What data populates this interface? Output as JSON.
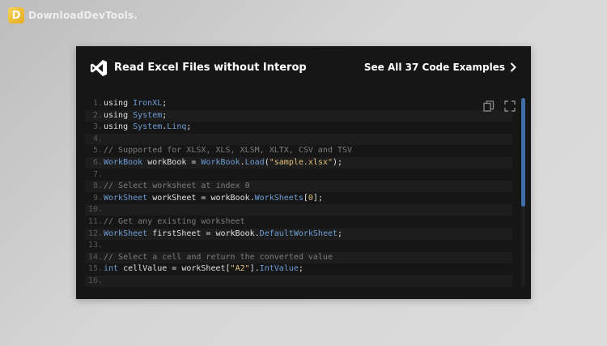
{
  "watermark": {
    "logo_letter": "D",
    "text": "DownloadDevTools."
  },
  "card": {
    "title": "Read Excel Files without Interop",
    "see_all_label": "See All 37 Code Examples",
    "accent_color": "#3f6ea8"
  },
  "icons": {
    "brand": "visual-studio-icon",
    "see_all": "chevron-right-icon",
    "copy": "copy-icon",
    "expand": "fullscreen-icon"
  },
  "code": [
    {
      "num": "1.",
      "tokens": [
        [
          "plain",
          "using "
        ],
        [
          "type",
          "IronXL"
        ],
        [
          "plain",
          ";"
        ]
      ]
    },
    {
      "num": "2.",
      "tokens": [
        [
          "plain",
          "using "
        ],
        [
          "type",
          "System"
        ],
        [
          "plain",
          ";"
        ]
      ]
    },
    {
      "num": "3.",
      "tokens": [
        [
          "plain",
          "using "
        ],
        [
          "type",
          "System"
        ],
        [
          "plain",
          "."
        ],
        [
          "type",
          "Linq"
        ],
        [
          "plain",
          ";"
        ]
      ]
    },
    {
      "num": "4.",
      "tokens": []
    },
    {
      "num": "5.",
      "tokens": [
        [
          "com",
          "// Supported for XLSX, XLS, XLSM, XLTX, CSV and TSV"
        ]
      ]
    },
    {
      "num": "6.",
      "tokens": [
        [
          "type",
          "WorkBook"
        ],
        [
          "plain",
          " workBook = "
        ],
        [
          "type",
          "WorkBook"
        ],
        [
          "plain",
          "."
        ],
        [
          "type",
          "Load"
        ],
        [
          "plain",
          "("
        ],
        [
          "str",
          "\"sample.xlsx\""
        ],
        [
          "plain",
          ");"
        ]
      ]
    },
    {
      "num": "7.",
      "tokens": []
    },
    {
      "num": "8.",
      "tokens": [
        [
          "com",
          "// Select worksheet at index 0"
        ]
      ]
    },
    {
      "num": "9.",
      "tokens": [
        [
          "type",
          "WorkSheet"
        ],
        [
          "plain",
          " workSheet = workBook."
        ],
        [
          "type",
          "WorkSheets"
        ],
        [
          "plain",
          "["
        ],
        [
          "num",
          "0"
        ],
        [
          "plain",
          "];"
        ]
      ]
    },
    {
      "num": "10.",
      "tokens": []
    },
    {
      "num": "11.",
      "tokens": [
        [
          "com",
          "// Get any existing worksheet"
        ]
      ]
    },
    {
      "num": "12.",
      "tokens": [
        [
          "type",
          "WorkSheet"
        ],
        [
          "plain",
          " firstSheet = workBook."
        ],
        [
          "type",
          "DefaultWorkSheet"
        ],
        [
          "plain",
          ";"
        ]
      ]
    },
    {
      "num": "13.",
      "tokens": []
    },
    {
      "num": "14.",
      "tokens": [
        [
          "com",
          "// Select a cell and return the converted value"
        ]
      ]
    },
    {
      "num": "15.",
      "tokens": [
        [
          "type",
          "int"
        ],
        [
          "plain",
          " cellValue = workSheet["
        ],
        [
          "str",
          "\"A2\""
        ],
        [
          "plain",
          "]."
        ],
        [
          "type",
          "IntValue"
        ],
        [
          "plain",
          ";"
        ]
      ]
    },
    {
      "num": "16.",
      "tokens": []
    }
  ]
}
